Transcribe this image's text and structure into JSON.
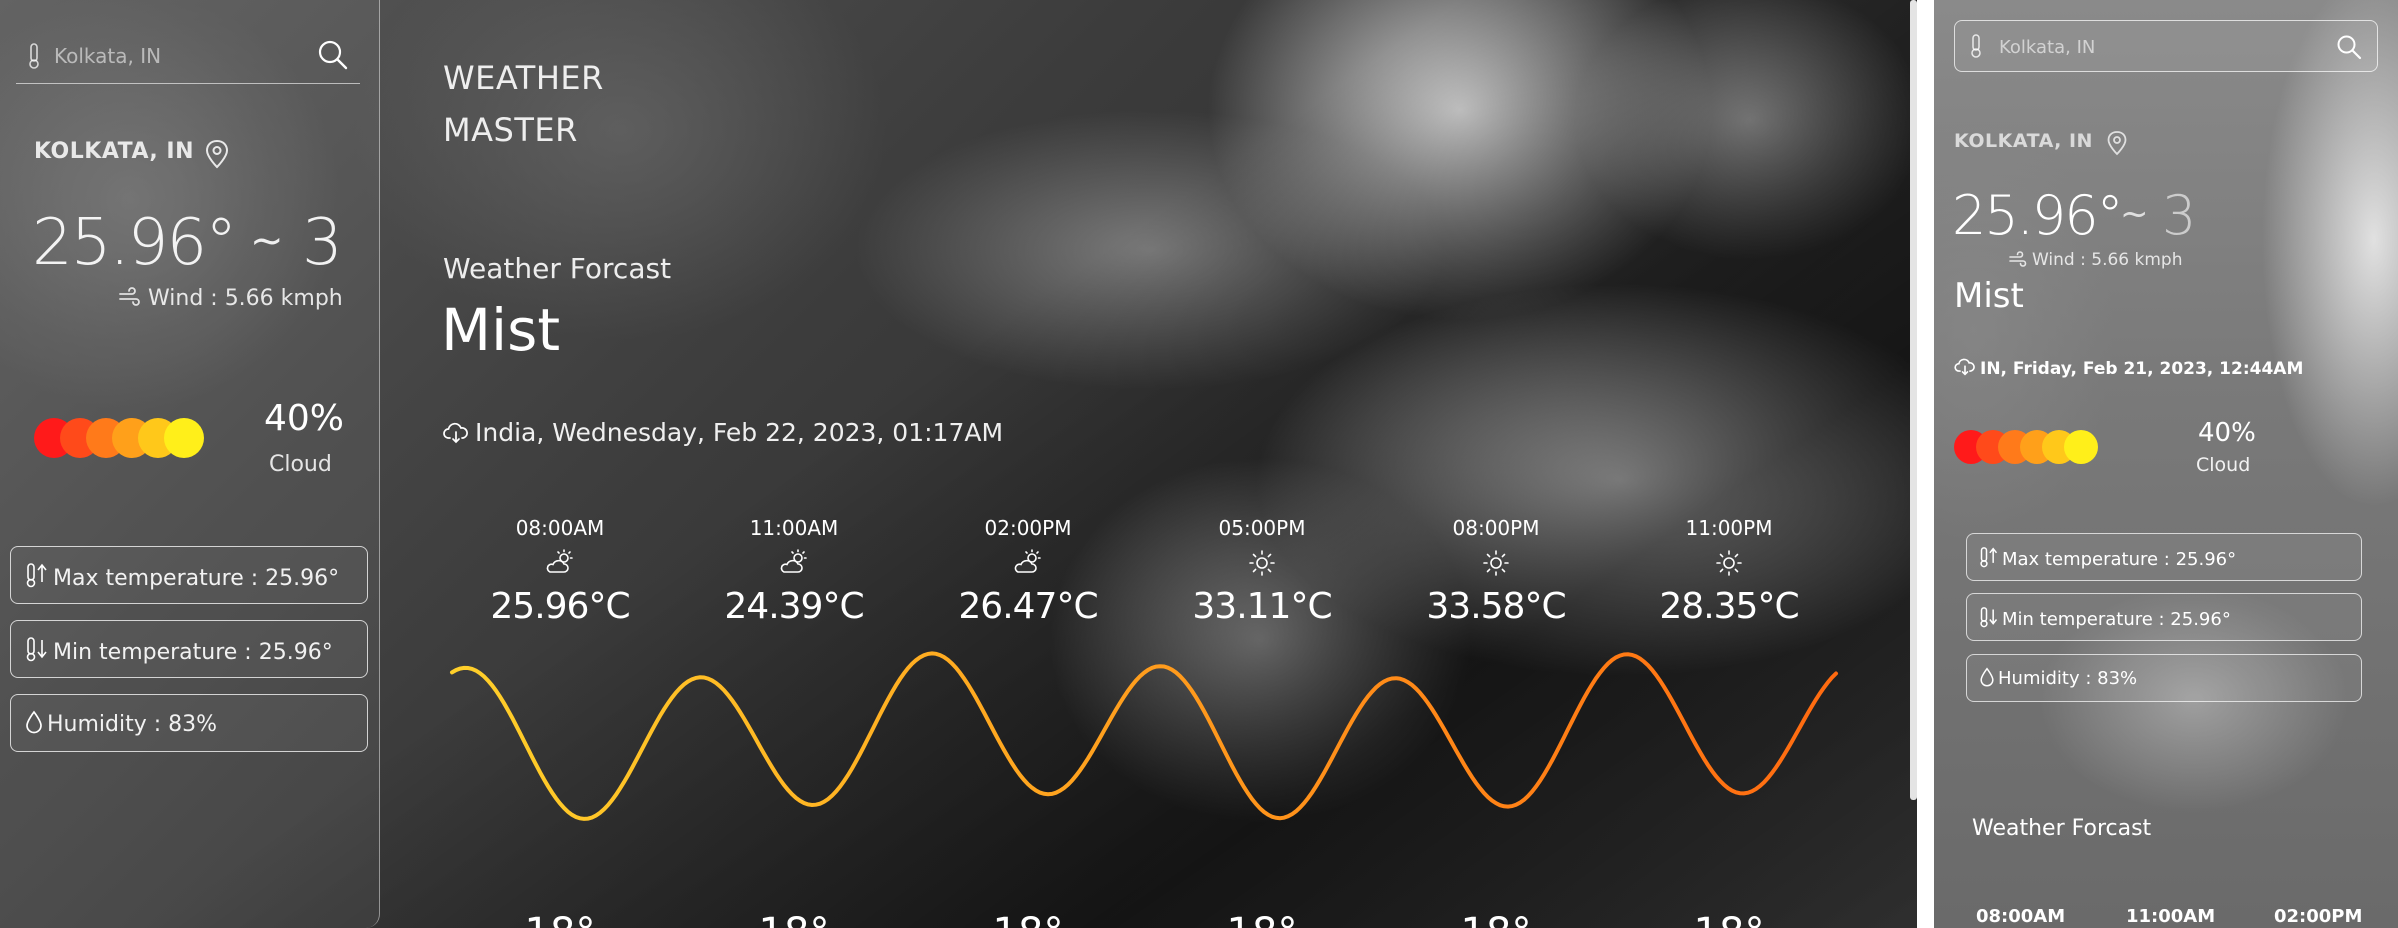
{
  "desktop": {
    "search": {
      "placeholder": "Kolkata, IN"
    },
    "location": "KOLKATA, IN",
    "temperature": "25.96°",
    "tilde": "~",
    "feels_value": "3",
    "wind": "Wind : 5.66 kmph",
    "cloud": {
      "percent": "40%",
      "label": "Cloud"
    },
    "cloud_dot_colors": [
      "#ff1a1a",
      "#ff4a1a",
      "#ff7a1a",
      "#ffa01a",
      "#ffc81a",
      "#ffef1a"
    ],
    "stats": {
      "max": "Max temperature : 25.96°",
      "min": "Min temperature : 25.96°",
      "humidity": "Humidity : 83%"
    },
    "app_title_line1": "WEATHER",
    "app_title_line2": "MASTER",
    "forecast_label": "Weather Forcast",
    "condition": "Mist",
    "datetime": "India, Wednesday, Feb 22, 2023, 01:17AM",
    "hourly": [
      {
        "time": "08:00AM",
        "icon": "partly-cloudy-icon",
        "temp": "25.96°C"
      },
      {
        "time": "11:00AM",
        "icon": "partly-cloudy-icon",
        "temp": "24.39°C"
      },
      {
        "time": "02:00PM",
        "icon": "partly-cloudy-icon",
        "temp": "26.47°C"
      },
      {
        "time": "05:00PM",
        "icon": "sun-icon",
        "temp": "33.11°C"
      },
      {
        "time": "08:00PM",
        "icon": "sun-icon",
        "temp": "33.58°C"
      },
      {
        "time": "11:00PM",
        "icon": "sun-icon",
        "temp": "28.35°C"
      }
    ],
    "wave_colors": [
      "#ffd02a",
      "#ff6a10"
    ]
  },
  "mobile": {
    "search": {
      "placeholder": "Kolkata, IN"
    },
    "location": "KOLKATA, IN",
    "temperature": "25.96°",
    "tilde": "~",
    "feels_value": "3",
    "wind": "Wind : 5.66 kmph",
    "condition": "Mist",
    "datetime": "IN, Friday, Feb 21, 2023, 12:44AM",
    "cloud": {
      "percent": "40%",
      "label": "Cloud"
    },
    "stats": {
      "max": "Max temperature : 25.96°",
      "min": "Min temperature : 25.96°",
      "humidity": "Humidity : 83%"
    },
    "forecast_label": "Weather Forcast",
    "hour_labels": [
      "08:00AM",
      "11:00AM",
      "02:00PM"
    ]
  }
}
